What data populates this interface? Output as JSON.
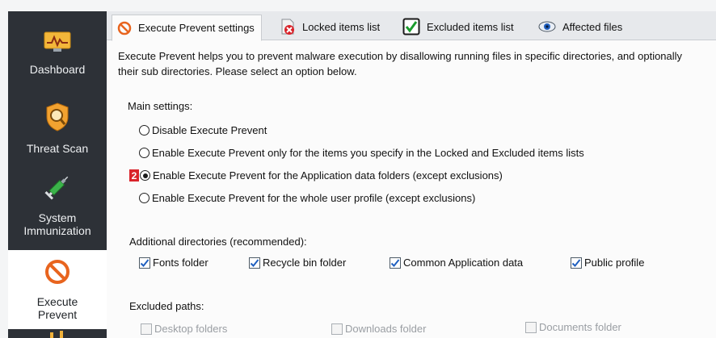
{
  "sidebar": {
    "items": [
      {
        "label": "Dashboard",
        "icon": "dashboard-icon",
        "active": false
      },
      {
        "label": "Threat Scan",
        "icon": "shield-search-icon",
        "active": false
      },
      {
        "label": "System\nImmunization",
        "icon": "syringe-icon",
        "active": false
      },
      {
        "label": "Execute\nPrevent",
        "icon": "no-entry-icon",
        "active": true
      }
    ]
  },
  "tabs": [
    {
      "label": "Execute Prevent settings",
      "icon": "no-entry-icon",
      "active": true
    },
    {
      "label": "Locked items list",
      "icon": "locked-file-icon",
      "active": false
    },
    {
      "label": "Excluded items list",
      "icon": "check-box-icon",
      "active": false
    },
    {
      "label": "Affected files",
      "icon": "eye-icon",
      "active": false
    }
  ],
  "description": "Execute Prevent helps you to prevent malware execution by disallowing running files in specific directories, and optionally their sub directories. Please select an option below.",
  "main_settings": {
    "label": "Main settings:",
    "options": [
      {
        "label": "Disable Execute Prevent",
        "selected": false
      },
      {
        "label": "Enable Execute Prevent only for the items you specify in the Locked and Excluded items lists",
        "selected": false
      },
      {
        "label": "Enable Execute Prevent for the Application data folders (except exclusions)",
        "selected": true,
        "marker": "2"
      },
      {
        "label": "Enable Execute Prevent for the whole user profile (except exclusions)",
        "selected": false
      }
    ]
  },
  "additional_directories": {
    "label": "Additional directories (recommended):",
    "items": [
      {
        "label": "Fonts folder",
        "checked": true
      },
      {
        "label": "Recycle bin folder",
        "checked": true
      },
      {
        "label": "Common Application data",
        "checked": true
      },
      {
        "label": "Public profile",
        "checked": true
      }
    ]
  },
  "excluded_paths": {
    "label": "Excluded paths:",
    "items": [
      {
        "label": "Desktop folders",
        "checked": false,
        "enabled": false
      },
      {
        "label": "Downloads folder",
        "checked": false,
        "enabled": false
      },
      {
        "label": "Documents folder",
        "checked": false,
        "enabled": false
      }
    ]
  },
  "colors": {
    "sidebar_bg": "#2d3137",
    "accent_orange": "#e8641e",
    "marker_red": "#d9232a",
    "checkmark_blue": "#1f5fbf",
    "check_green": "#1a9b2c"
  }
}
